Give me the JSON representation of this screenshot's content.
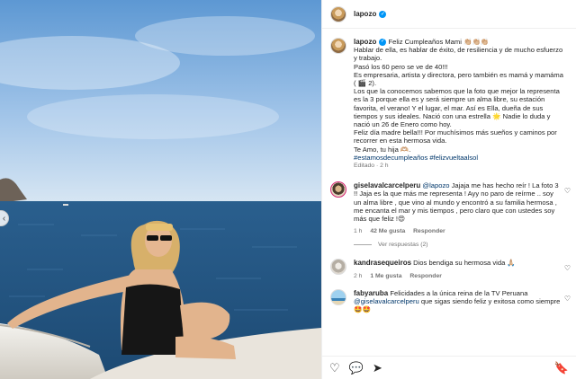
{
  "post": {
    "username": "lapozo",
    "caption_lines": [
      "Feliz Cumpleaños Mami 👏🏼👏🏼👏🏼",
      "Hablar de ella, es hablar de éxito, de resiliencia y de mucho esfuerzo y trabajo.",
      "Pasó los 60 pero se ve de 40!!!",
      "Es empresaria, artista y directora, pero también es mamá y mamáma ( 🎬 2).",
      "Los que la conocemos sabemos que la foto que mejor la representa es la 3 porque ella es y será siempre un alma libre, su estación favorita, el verano! Y el lugar, el mar. Así es Ella, dueña de sus tiempos y sus ideales. Nació con una estrella 🌟 Nadie lo duda y nació un 26 de Enero como hoy.",
      "Feliz día madre bella!!! Por muchísimos más sueños y caminos por recorrer en esta hermosa vida.",
      "Te Amo, tu hija 🫶🏼."
    ],
    "hashtags": "#estamosdecumpleaños #felizvueltaalsol",
    "edited_label": "Editado · 2 h"
  },
  "comments": [
    {
      "username": "giselavalcarcelperu",
      "mention": "@lapozo",
      "text": " Jajaja me has hecho reír ! La foto 3 !! Jaja es la que más me representa ! Ayy no paro de reírme .. soy un alma libre , que vino al mundo y encontró a su familia hermosa , me encanta el mar y mis tiempos , pero claro que con ustedes soy más que feliz !😍",
      "time": "1 h",
      "likes": "42 Me gusta",
      "reply": "Responder",
      "view_replies": "Ver respuestas (2)"
    },
    {
      "username": "kandrasequeiros",
      "text": " Dios bendiga su hermosa vida 🙏🏼",
      "time": "2 h",
      "likes": "1 Me gusta",
      "reply": "Responder"
    },
    {
      "username": "fabyaruba",
      "text": " Felicidades a la única reina de la TV Peruana ",
      "mention": "@giselavalcarcelperu",
      "text2": " que sigas siendo feliz y exitosa como siempre 🤩🤩"
    }
  ],
  "icons": {
    "verified": "✓",
    "heart": "♡",
    "comment": "💬",
    "share": "➤",
    "save": "🔖",
    "prev": "‹"
  },
  "colors": {
    "link": "#00376b",
    "verified": "#0095f6",
    "muted": "#737373"
  }
}
